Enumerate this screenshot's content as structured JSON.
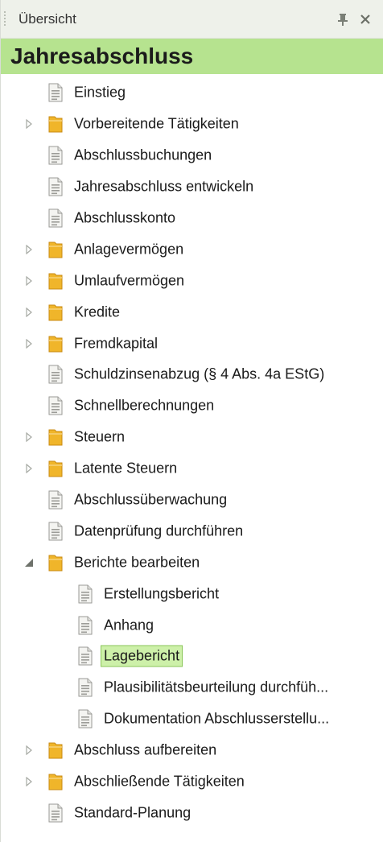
{
  "panel": {
    "title": "Übersicht",
    "pin_icon": "pin-icon",
    "close_icon": "close-icon"
  },
  "banner": {
    "title": "Jahresabschluss"
  },
  "colors": {
    "banner": "#b6e38f",
    "folder": "#f0b52a",
    "selection": "#cdf0a9",
    "selection_border": "#8bc65a"
  },
  "tree": [
    {
      "label": "Einstieg",
      "type": "document",
      "level": 0,
      "expander": "none"
    },
    {
      "label": "Vorbereitende Tätigkeiten",
      "type": "folder",
      "level": 0,
      "expander": "collapsed"
    },
    {
      "label": "Abschlussbuchungen",
      "type": "document",
      "level": 0,
      "expander": "none"
    },
    {
      "label": "Jahresabschluss entwickeln",
      "type": "document",
      "level": 0,
      "expander": "none"
    },
    {
      "label": "Abschlusskonto",
      "type": "document",
      "level": 0,
      "expander": "none"
    },
    {
      "label": "Anlagevermögen",
      "type": "folder",
      "level": 0,
      "expander": "collapsed"
    },
    {
      "label": "Umlaufvermögen",
      "type": "folder",
      "level": 0,
      "expander": "collapsed"
    },
    {
      "label": "Kredite",
      "type": "folder",
      "level": 0,
      "expander": "collapsed"
    },
    {
      "label": "Fremdkapital",
      "type": "folder",
      "level": 0,
      "expander": "collapsed"
    },
    {
      "label": "Schuldzinsenabzug (§ 4 Abs. 4a EStG)",
      "type": "document",
      "level": 0,
      "expander": "none"
    },
    {
      "label": "Schnellberechnungen",
      "type": "document",
      "level": 0,
      "expander": "none"
    },
    {
      "label": "Steuern",
      "type": "folder",
      "level": 0,
      "expander": "collapsed"
    },
    {
      "label": "Latente Steuern",
      "type": "folder",
      "level": 0,
      "expander": "collapsed"
    },
    {
      "label": "Abschlussüberwachung",
      "type": "document",
      "level": 0,
      "expander": "none"
    },
    {
      "label": "Datenprüfung durchführen",
      "type": "document",
      "level": 0,
      "expander": "none"
    },
    {
      "label": "Berichte bearbeiten",
      "type": "folder",
      "level": 0,
      "expander": "expanded"
    },
    {
      "label": "Erstellungsbericht",
      "type": "document",
      "level": 1,
      "expander": "none"
    },
    {
      "label": "Anhang",
      "type": "document",
      "level": 1,
      "expander": "none"
    },
    {
      "label": "Lagebericht",
      "type": "document",
      "level": 1,
      "expander": "none",
      "selected": true
    },
    {
      "label": "Plausibilitätsbeurteilung durchfüh...",
      "type": "document",
      "level": 1,
      "expander": "none"
    },
    {
      "label": "Dokumentation Abschlusserstellu...",
      "type": "document",
      "level": 1,
      "expander": "none"
    },
    {
      "label": "Abschluss aufbereiten",
      "type": "folder",
      "level": 0,
      "expander": "collapsed"
    },
    {
      "label": "Abschließende Tätigkeiten",
      "type": "folder",
      "level": 0,
      "expander": "collapsed"
    },
    {
      "label": "Standard-Planung",
      "type": "document",
      "level": 0,
      "expander": "none"
    }
  ]
}
